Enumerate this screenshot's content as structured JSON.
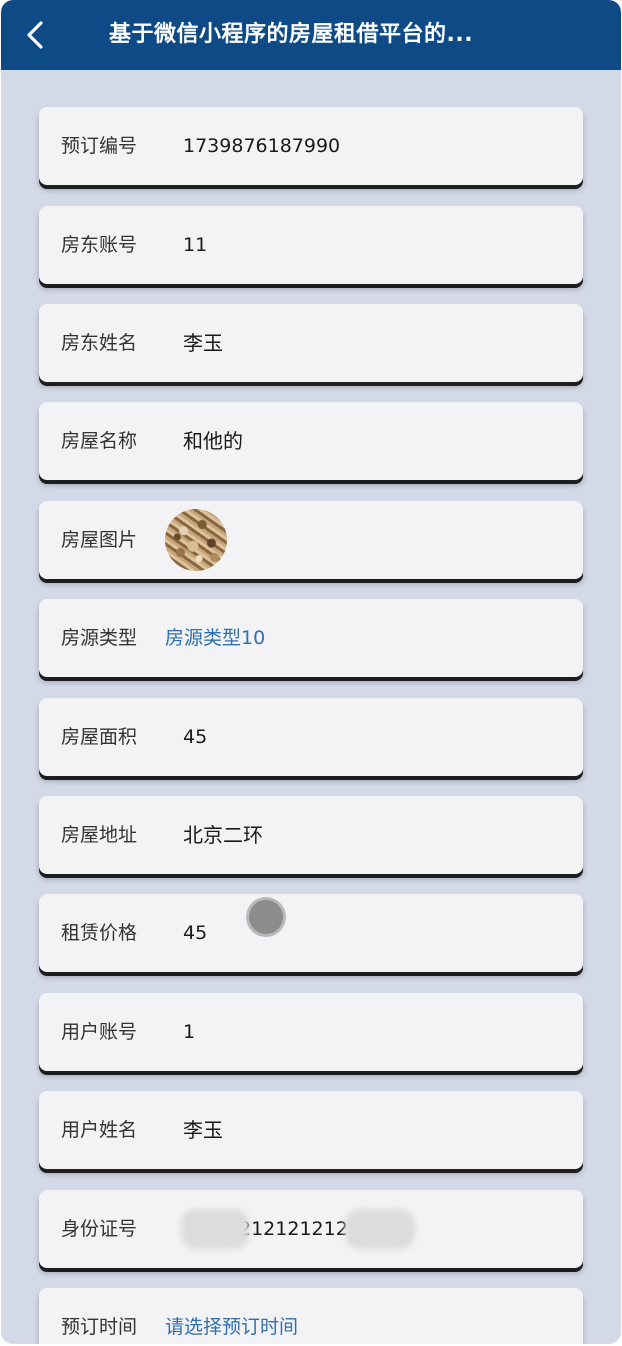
{
  "navbar": {
    "title": "基于微信小程序的房屋租借平台的...",
    "back_icon": "chevron-left-icon",
    "bg_color": "#0e4b86"
  },
  "fields": [
    {
      "label": "预订编号",
      "value": "1739876187990"
    },
    {
      "label": "房东账号",
      "value": "11"
    },
    {
      "label": "房东姓名",
      "value": "李玉"
    },
    {
      "label": "房屋名称",
      "value": "和他的"
    },
    {
      "label": "房屋图片",
      "value": ""
    },
    {
      "label": "房源类型",
      "value": "房源类型10"
    },
    {
      "label": "房屋面积",
      "value": "45"
    },
    {
      "label": "房屋地址",
      "value": "北京二环"
    },
    {
      "label": "租赁价格",
      "value": "45"
    },
    {
      "label": "用户账号",
      "value": "1"
    },
    {
      "label": "用户姓名",
      "value": "李玉"
    },
    {
      "label": "身份证号",
      "value": "212121212"
    },
    {
      "label": "预订时间",
      "value": "请选择预订时间"
    }
  ],
  "colors": {
    "page_bg": "#d3d9e7",
    "card_bg": "#f3f3f5",
    "link": "#2f6fb0"
  }
}
